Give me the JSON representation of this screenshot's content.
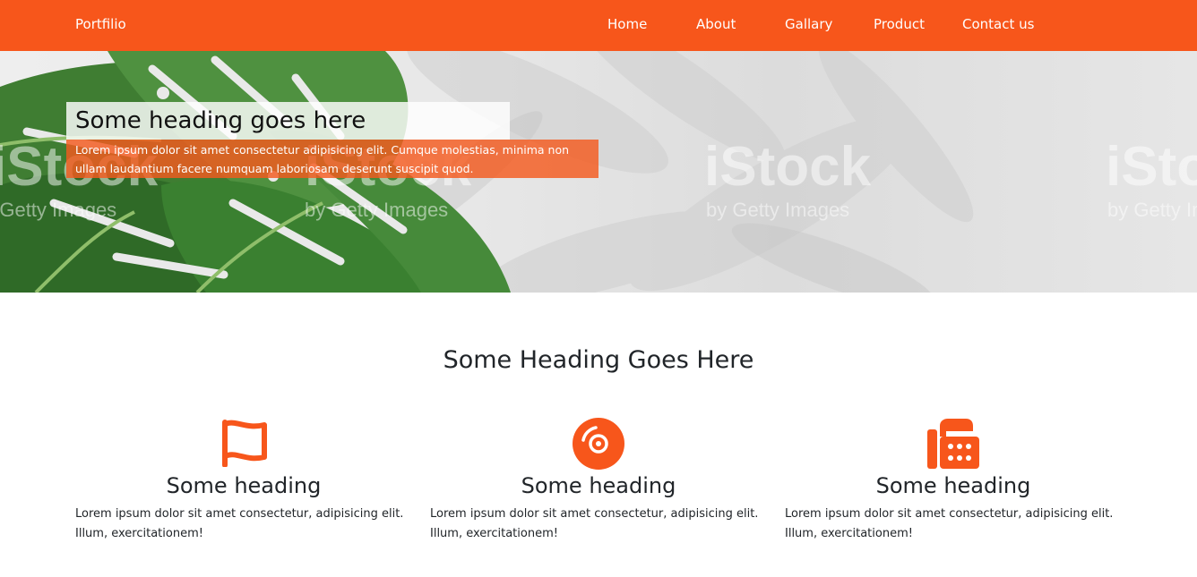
{
  "nav": {
    "brand": "Portfilio",
    "links": [
      "Home",
      "About",
      "Gallary",
      "Product",
      "Contact us"
    ]
  },
  "hero": {
    "title": "Some heading goes here",
    "subtitle": "Lorem ipsum dolor sit amet consectetur adipisicing elit. Cumque molestias, minima non ullam laudantium facere numquam laboriosam deserunt suscipit quod.",
    "watermark": "iStock",
    "watermark_sub": "by Getty Images"
  },
  "section": {
    "title": "Some Heading Goes Here"
  },
  "features": [
    {
      "icon": "flag-icon",
      "heading": "Some heading",
      "text": "Lorem ipsum dolor sit amet consectetur, adipisicing elit. Illum, exercitationem!"
    },
    {
      "icon": "disc-icon",
      "heading": "Some heading",
      "text": "Lorem ipsum dolor sit amet consectetur, adipisicing elit. Illum, exercitationem!"
    },
    {
      "icon": "fax-icon",
      "heading": "Some heading",
      "text": "Lorem ipsum dolor sit amet consectetur, adipisicing elit. Illum, exercitationem!"
    }
  ],
  "colors": {
    "accent": "#f7561b",
    "text": "#212529",
    "white": "#ffffff"
  }
}
